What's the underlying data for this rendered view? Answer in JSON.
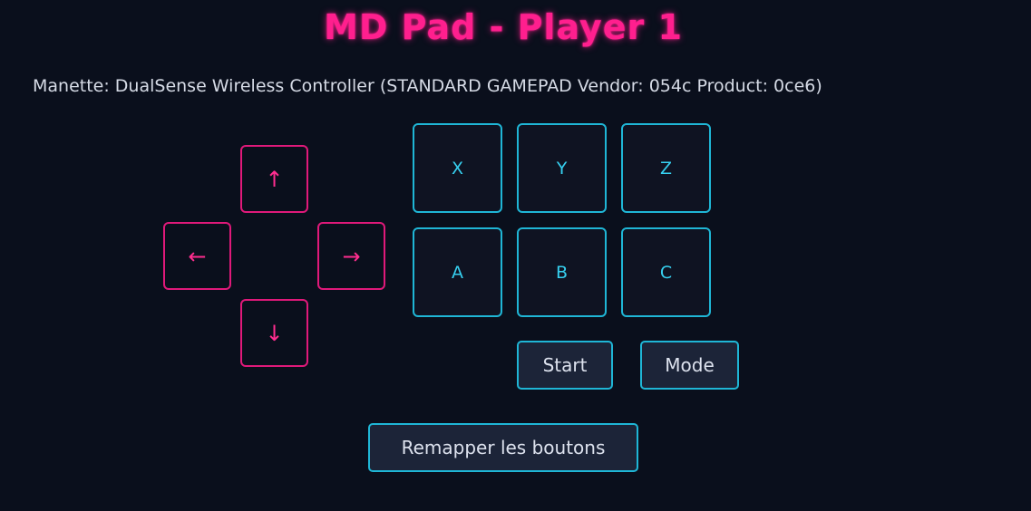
{
  "header": {
    "title": "MD Pad - Player 1"
  },
  "controller": {
    "info": "Manette: DualSense Wireless Controller (STANDARD GAMEPAD Vendor: 054c Product: 0ce6)"
  },
  "dpad": {
    "up": "↑",
    "left": "←",
    "right": "→",
    "down": "↓"
  },
  "face_buttons": {
    "x": "X",
    "y": "Y",
    "z": "Z",
    "a": "A",
    "b": "B",
    "c": "C"
  },
  "system_buttons": {
    "start": "Start",
    "mode": "Mode"
  },
  "actions": {
    "remap": "Remapper les boutons"
  },
  "colors": {
    "background": "#0a0f1c",
    "title": "#ff1f8e",
    "dpad_border": "#e0197a",
    "face_border": "#1fb6d6",
    "face_text": "#36d0f0"
  }
}
